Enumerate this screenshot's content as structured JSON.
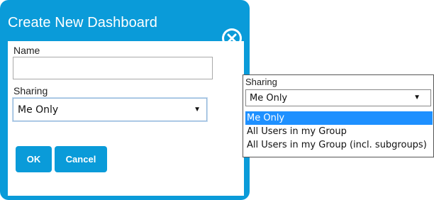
{
  "dialog": {
    "title": "Create New Dashboard",
    "name_label": "Name",
    "name_value": "",
    "sharing_label": "Sharing",
    "sharing_value": "Me Only",
    "ok_label": "OK",
    "cancel_label": "Cancel"
  },
  "dropdown": {
    "label": "Sharing",
    "selected": "Me Only",
    "options": [
      "Me Only",
      "All Users in my Group",
      "All Users in my Group (incl. subgroups)"
    ]
  },
  "icons": {
    "close": "close-icon",
    "dropdown_arrow": "chevron-down-icon"
  },
  "colors": {
    "accent": "#0a9bd9",
    "selected_option": "#1e90ff"
  }
}
